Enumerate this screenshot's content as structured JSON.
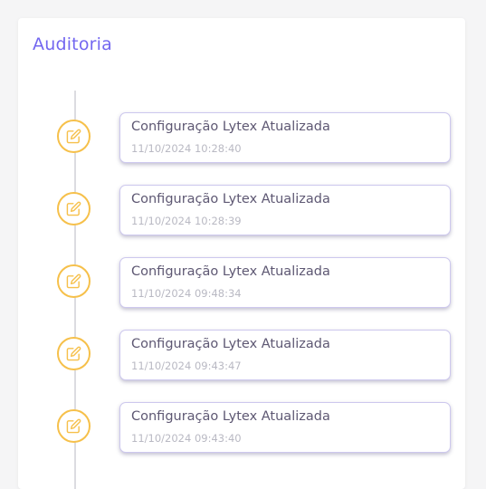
{
  "audit": {
    "title": "Auditoria",
    "accent_color": "#7367f0",
    "icon_color": "#f6c04a",
    "entries": [
      {
        "icon": "edit-icon",
        "title": "Configuração Lytex Atualizada",
        "date": "11/10/2024 10:28:40"
      },
      {
        "icon": "edit-icon",
        "title": "Configuração Lytex Atualizada",
        "date": "11/10/2024 10:28:39"
      },
      {
        "icon": "edit-icon",
        "title": "Configuração Lytex Atualizada",
        "date": "11/10/2024 09:48:34"
      },
      {
        "icon": "edit-icon",
        "title": "Configuração Lytex Atualizada",
        "date": "11/10/2024 09:43:47"
      },
      {
        "icon": "edit-icon",
        "title": "Configuração Lytex Atualizada",
        "date": "11/10/2024 09:43:40"
      }
    ]
  }
}
